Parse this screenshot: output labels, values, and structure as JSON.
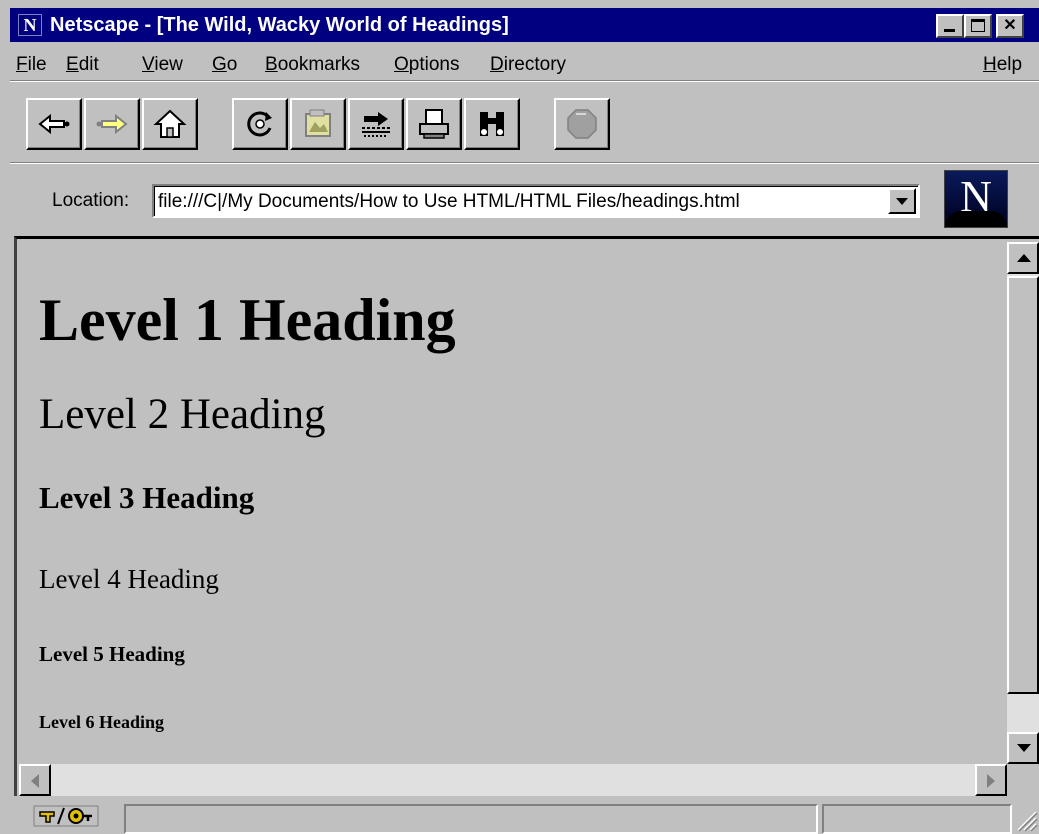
{
  "window": {
    "title": "Netscape - [The Wild, Wacky World of Headings]",
    "app_icon": "N",
    "title_color": "#000080"
  },
  "menubar": {
    "items": [
      {
        "label": "File",
        "mnemonic": "F"
      },
      {
        "label": "Edit",
        "mnemonic": "E"
      },
      {
        "label": "View",
        "mnemonic": "V"
      },
      {
        "label": "Go",
        "mnemonic": "G"
      },
      {
        "label": "Bookmarks",
        "mnemonic": "B"
      },
      {
        "label": "Options",
        "mnemonic": "O"
      },
      {
        "label": "Directory",
        "mnemonic": "D"
      },
      {
        "label": "Help",
        "mnemonic": "H"
      }
    ]
  },
  "toolbar": {
    "buttons": [
      {
        "icon": "back-arrow-icon",
        "enabled": true
      },
      {
        "icon": "forward-arrow-icon",
        "enabled": false
      },
      {
        "icon": "home-icon",
        "enabled": true
      },
      {
        "icon": "reload-icon",
        "enabled": true
      },
      {
        "icon": "images-icon",
        "enabled": false
      },
      {
        "icon": "open-icon",
        "enabled": true
      },
      {
        "icon": "print-icon",
        "enabled": true
      },
      {
        "icon": "find-icon",
        "enabled": true
      },
      {
        "icon": "stop-icon",
        "enabled": false
      }
    ]
  },
  "location": {
    "label": "Location:",
    "url": "file:///C|/My Documents/How to Use HTML/HTML Files/headings.html"
  },
  "brand": {
    "logo_letter": "N"
  },
  "page": {
    "background": "#c0c0c0",
    "headings": [
      {
        "level": 1,
        "text": "Level 1 Heading"
      },
      {
        "level": 2,
        "text": "Level 2 Heading"
      },
      {
        "level": 3,
        "text": "Level 3 Heading"
      },
      {
        "level": 4,
        "text": "Level 4 Heading"
      },
      {
        "level": 5,
        "text": "Level 5 Heading"
      },
      {
        "level": 6,
        "text": "Level 6 Heading"
      }
    ]
  },
  "statusbar": {
    "security_icon": "broken-key-icon",
    "status_text": ""
  }
}
